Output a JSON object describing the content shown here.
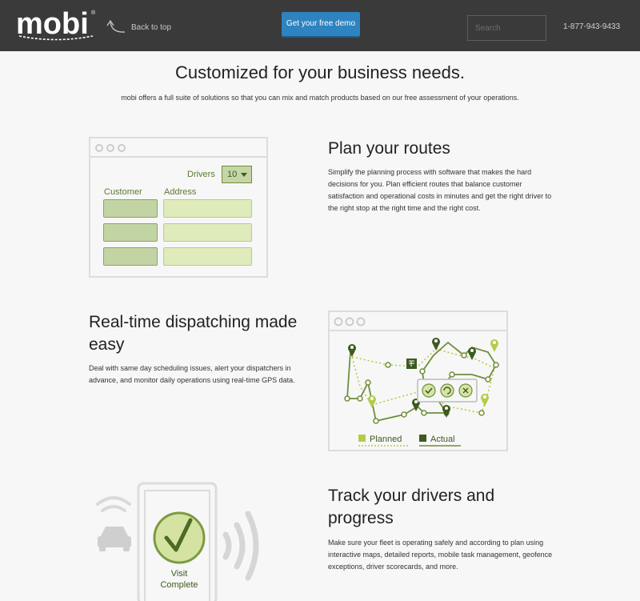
{
  "header": {
    "brand": "mobi",
    "brand_mark": "®",
    "back_label": "Back to top",
    "demo_label": "Get your free demo",
    "search_placeholder": "Search",
    "phone": "1-877-943-9433"
  },
  "intro": {
    "title": "Customized for your business needs.",
    "subtitle": "mobi offers a full suite of solutions so that you can mix and match products based on our free assessment of your operations."
  },
  "routes": {
    "title": "Plan your routes",
    "body": "Simplify the planning process with software that makes the hard decisions for you. Plan efficient routes that balance customer satisfaction and operational costs in minutes and get the right driver to the right stop at the right time and the right cost.",
    "drivers_label": "Drivers",
    "drivers_value": "10",
    "customer_label": "Customer",
    "address_label": "Address"
  },
  "dispatch": {
    "title": "Real-time dispatching made easy",
    "body": "Deal with same day scheduling issues, alert your dispatchers in advance, and monitor daily operations using real-time GPS data.",
    "legend_planned": "Planned",
    "legend_actual": "Actual"
  },
  "track": {
    "title": "Track your drivers and progress",
    "body": "Make sure your fleet is operating safely and according to plan using interactive maps, detailed reports, mobile task management, geofence exceptions, driver scorecards, and more.",
    "status_line1": "Visit",
    "status_line2": "Complete"
  },
  "colors": {
    "header_bg": "#3a3a3a",
    "accent_blue": "#2f83c1",
    "planned": "#b5cc4a",
    "actual": "#6f8e3c"
  }
}
